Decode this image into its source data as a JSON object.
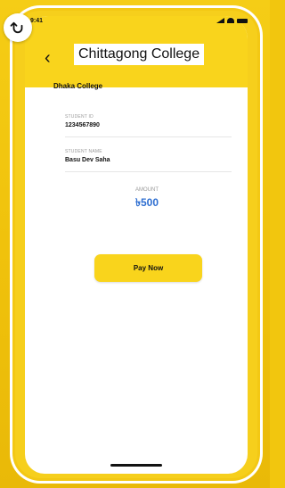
{
  "status_bar": {
    "time": "9:41"
  },
  "header": {
    "title": "Chittagong College",
    "back_icon": "chevron-left-icon"
  },
  "payment": {
    "institution": "Dhaka College",
    "student_id_label": "STUDENT ID",
    "student_id": "1234567890",
    "student_name_label": "STUDENT NAME",
    "student_name": "Basu Dev Saha",
    "amount_label": "AMOUNT",
    "amount": "৳500"
  },
  "actions": {
    "pay_label": "Pay Now"
  },
  "colors": {
    "accent": "#f9d41c",
    "amount": "#2f6fd1"
  }
}
